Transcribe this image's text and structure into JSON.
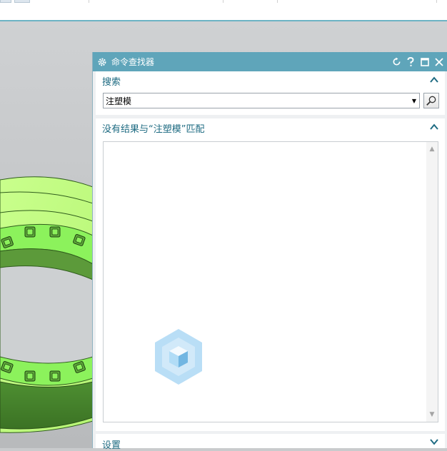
{
  "dialog": {
    "title": "命令查找器",
    "search_section": {
      "heading": "搜索",
      "input_value": "注塑模"
    },
    "results_section": {
      "heading": "没有结果与“注塑模”匹配"
    },
    "settings_section": {
      "heading": "设置"
    }
  },
  "colors": {
    "titlebar": "#5fa5ba",
    "heading_text": "#1e6b82",
    "model_green": "#7fe05a"
  },
  "icons": [
    "gear-icon",
    "reset-icon",
    "help-icon",
    "maximize-icon",
    "close-icon",
    "chevron-up-icon",
    "dropdown-arrow-icon",
    "search-icon",
    "chevron-down-icon",
    "scroll-up-icon",
    "scroll-down-icon"
  ]
}
